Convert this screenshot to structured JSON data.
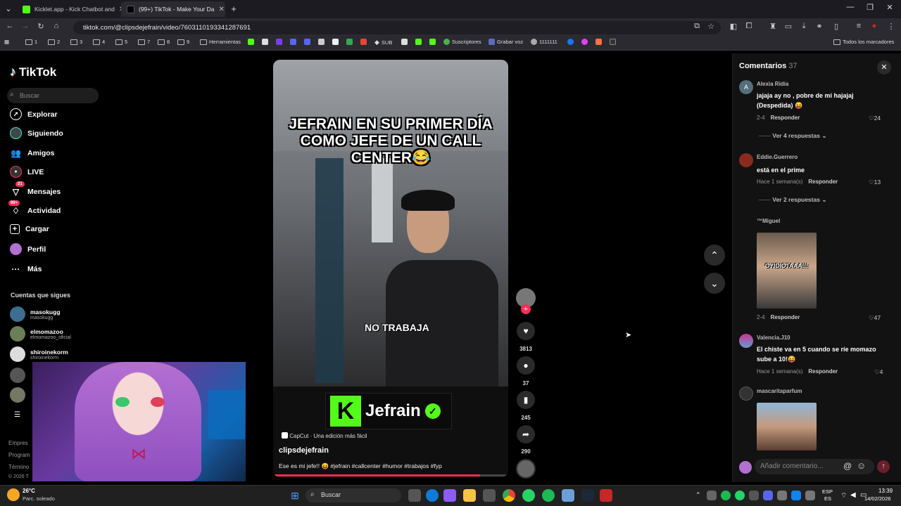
{
  "browser": {
    "tabs": [
      {
        "label": "Kicklet.app - Kick Chatbot and"
      },
      {
        "label": "(99+) TikTok - Make Your Da"
      }
    ],
    "new_tab": "+",
    "url": "tiktok.com/@clipsdejefrain/video/7603110193341287691",
    "bookmarks": [
      "1",
      "2",
      "3",
      "4",
      "5",
      "7",
      "8",
      "9",
      "Herramientas",
      "SUB",
      "Suscriptores",
      "Grabar voz",
      "1111111"
    ],
    "all_bookmarks": "Todos los marcadores"
  },
  "sidebar": {
    "brand": "TikTok",
    "search_placeholder": "Buscar",
    "nav": [
      {
        "label": "Explorar"
      },
      {
        "label": "Siguiendo"
      },
      {
        "label": "Amigos"
      },
      {
        "label": "LIVE"
      },
      {
        "label": "Mensajes",
        "badge": "21"
      },
      {
        "label": "Actividad",
        "badge": "99+"
      },
      {
        "label": "Cargar"
      },
      {
        "label": "Perfil"
      },
      {
        "label": "Más"
      }
    ],
    "following_title": "Cuentas que sigues",
    "following": [
      {
        "name": "masokugg",
        "handle": "masokugg"
      },
      {
        "name": "elmomazoo",
        "handle": "elmomazoo_oficial"
      },
      {
        "name": "shiroinekorm",
        "handle": "shiroinekorm"
      }
    ],
    "footer": [
      "Empres",
      "Program",
      "Término",
      "© 2026 T"
    ]
  },
  "video": {
    "title": "JEFRAIN EN SU PRIMER DÍA COMO JEFE DE UN CALL CENTER😂",
    "overlay_caption": "NO TRABAJA",
    "brand_name": "Jefrain",
    "capcut": "CapCut · Una edición más fácil",
    "username": "clipsdejefrain",
    "description": "Ese es mi jefe!! 😝 #jefrain #callcenter #humor #trabajos #fyp",
    "progress": 0.88
  },
  "actions": {
    "likes": "3813",
    "comments": "37",
    "saves": "245",
    "shares": "290"
  },
  "comments": {
    "title": "Comentarios",
    "count": "37",
    "items": [
      {
        "user": "Alexia Ridia",
        "text": "jajaja ay no , pobre de mi hajajaj (Despedida) 😝",
        "date": "2-4",
        "reply": "Responder",
        "likes": "24",
        "more": "Ver 4 respuestas"
      },
      {
        "user": "Eddie.Guerrero",
        "text": "está en el prime",
        "date": "Hace 1 semana(s)",
        "reply": "Responder",
        "likes": "13",
        "more": "Ver 2 respuestas"
      },
      {
        "user": "™Miguel",
        "image_caption": "OYIDIOTAAA!!!",
        "date": "2-4",
        "reply": "Responder",
        "likes": "47"
      },
      {
        "user": "Valencia.J10",
        "text": "El chiste va en 5 cuando se ríe momazo sube a 10!😝",
        "date": "Hace 1 semana(s)",
        "reply": "Responder",
        "likes": "4"
      },
      {
        "user": "mascaritaparfum"
      }
    ],
    "input_placeholder": "Añadir comentario..."
  },
  "taskbar": {
    "weather_temp": "26°C",
    "weather_desc": "Parc. soleado",
    "search": "Buscar",
    "lang1": "ESP",
    "lang2": "ES",
    "time": "13:39",
    "date": "14/02/2026"
  }
}
